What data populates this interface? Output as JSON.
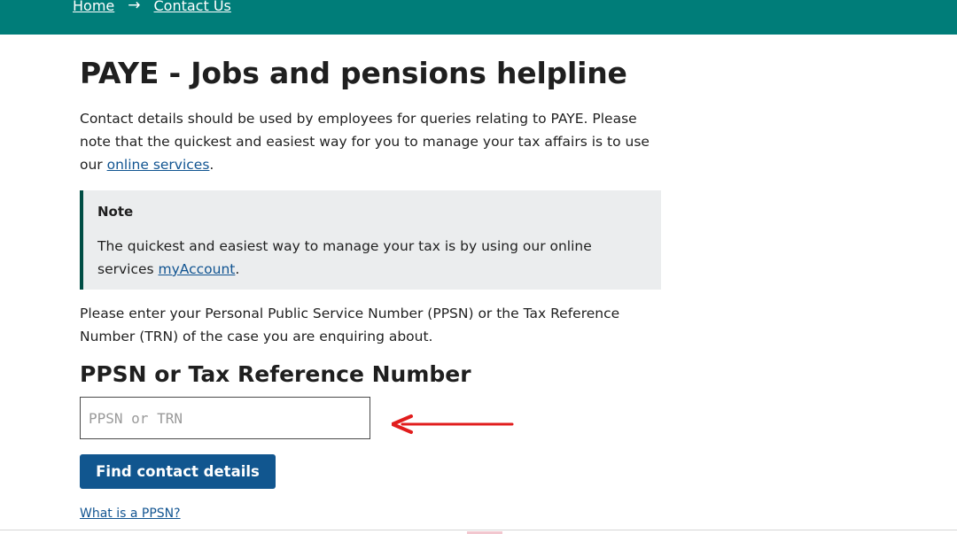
{
  "breadcrumb": {
    "home": "Home",
    "separator": "→",
    "contact": "Contact Us"
  },
  "page": {
    "title": "PAYE - Jobs and pensions helpline",
    "intro_before": "Contact details should be used by employees for queries relating to PAYE. Please note that the quickest and easiest way for you to manage your tax affairs is to use our ",
    "intro_link": "online services",
    "intro_after": ".",
    "note_title": "Note",
    "note_before": "The quickest and easiest way to manage your tax is by using our online services ",
    "note_link": "myAccount",
    "note_after": ".",
    "instruction": "Please enter your Personal Public Service Number (PPSN) or the Tax Reference Number (TRN) of the case you are enquiring about.",
    "field_label": "PPSN or Tax Reference Number",
    "field_value": "",
    "field_placeholder": "PPSN or TRN",
    "button_label": "Find contact details",
    "help_link": "What is a PPSN?"
  },
  "colors": {
    "header_bg": "#007d79",
    "button_bg": "#11568f",
    "link": "#115491",
    "note_bg": "#ebedee",
    "note_border": "#004d44",
    "arrow": "#e11d1d"
  },
  "icons": {
    "breadcrumb_separator": "arrow-right-icon",
    "annotation": "red-arrow-left-icon"
  }
}
